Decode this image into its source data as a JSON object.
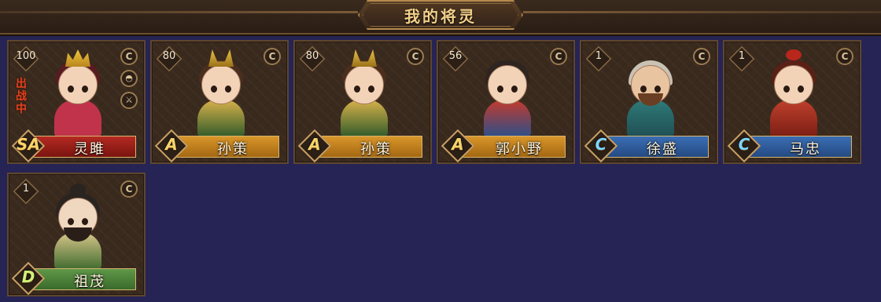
{
  "header": {
    "title": "我的将灵"
  },
  "cards": [
    {
      "level": "100",
      "rank": "SA",
      "name": "灵雎",
      "status": "出战中",
      "bar_color": "#b52a22"
    },
    {
      "level": "80",
      "rank": "A",
      "name": "孙策",
      "bar_color": "#d9962a"
    },
    {
      "level": "80",
      "rank": "A",
      "name": "孙策",
      "bar_color": "#d9962a"
    },
    {
      "level": "56",
      "rank": "A",
      "name": "郭小野",
      "bar_color": "#d9962a"
    },
    {
      "level": "1",
      "rank": "C",
      "name": "徐盛",
      "bar_color": "#3b6eb4"
    },
    {
      "level": "1",
      "rank": "C",
      "name": "马忠",
      "bar_color": "#3b6eb4"
    },
    {
      "level": "1",
      "rank": "D",
      "name": "祖茂",
      "bar_color": "#5f9848"
    }
  ],
  "icons": {
    "corner": "coin-icon",
    "side_1": "helmet-icon",
    "side_2": "sword-icon"
  }
}
